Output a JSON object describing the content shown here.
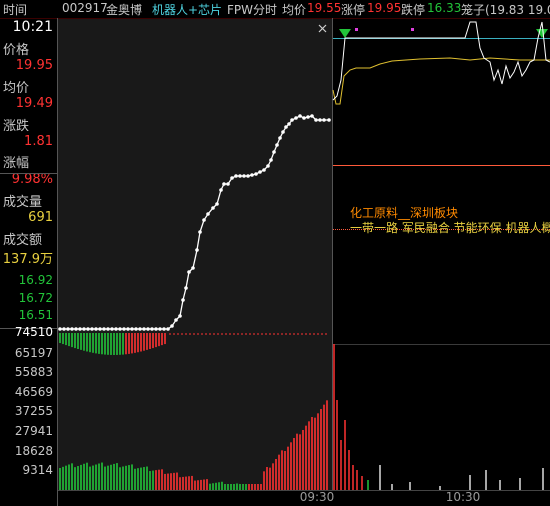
{
  "header": {
    "time_label": "时间",
    "code": "002917",
    "name": "金奥博",
    "concepts": "机器人+芯片",
    "mode": "FPW分时",
    "avg_label": "均价",
    "avg_value": "19.55",
    "limit_up_label": "涨停",
    "limit_up_value": "19.95",
    "limit_down_label": "跌停",
    "limit_down_value": "16.33",
    "cage_text": "笼子(19.83 19.0"
  },
  "side": {
    "time": "10:21",
    "price_label": "价格",
    "price_value": "19.95",
    "avg_label": "均价",
    "avg_value": "19.49",
    "change_label": "涨跌",
    "change_value": "1.81",
    "pct_label": "涨幅",
    "pct_value": "9.98%",
    "volume_label": "成交量",
    "volume_value": "691",
    "amount_label": "成交额",
    "amount_value": "137.9万"
  },
  "price_axis": [
    "16.92",
    "16.72",
    "16.51"
  ],
  "volume_axis": [
    "74510",
    "65197",
    "55883",
    "46569",
    "37255",
    "27941",
    "18628",
    "9314"
  ],
  "time_axis": [
    "09:30",
    "10:30"
  ],
  "close_icon": "close-icon",
  "sectors": {
    "line1": "化工原料__深圳板块",
    "line2": "一带一路  军民融合  节能环保  机器人概"
  },
  "colors": {
    "up": "#ff3232",
    "down": "#22c43a",
    "price_line": "#ffffff",
    "avg_line": "#e0c030",
    "cyan": "#3ab0c0",
    "label_yellow": "#e8d040",
    "sector_orange": "#ff8a00"
  }
}
